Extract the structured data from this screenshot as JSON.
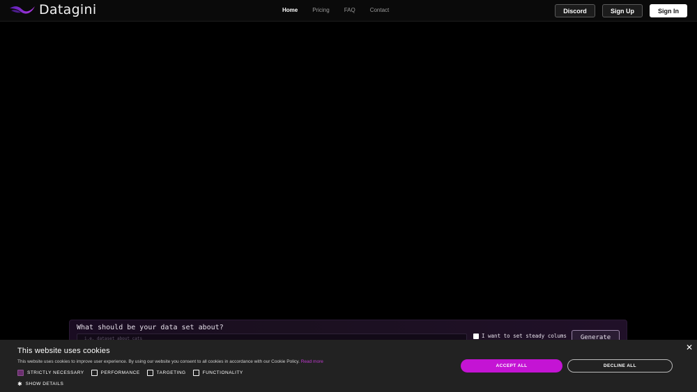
{
  "header": {
    "brand": "Datagini",
    "nav": [
      {
        "label": "Home",
        "active": true
      },
      {
        "label": "Pricing",
        "active": false
      },
      {
        "label": "FAQ",
        "active": false
      },
      {
        "label": "Contact",
        "active": false
      }
    ],
    "buttons": {
      "discord": "Discord",
      "sign_up": "Sign Up",
      "sign_in": "Sign In"
    },
    "logo_icon": "purple-wave-logo",
    "accent_color": "#7a2ad0"
  },
  "prompt": {
    "title": "What should be your data set about?",
    "placeholder": "i.e. dataset about cats",
    "steady_columns_label": "I want to set steady colums",
    "steady_columns_checked": false,
    "generate_label": "Generate"
  },
  "cookie_banner": {
    "title": "This website uses cookies",
    "description": "This website uses cookies to improve user experience. By using our website you consent to all cookies in accordance with our Cookie Policy.",
    "read_more": "Read more",
    "categories": [
      {
        "label": "STRICTLY NECESSARY",
        "checked": true
      },
      {
        "label": "PERFORMANCE",
        "checked": false
      },
      {
        "label": "TARGETING",
        "checked": false
      },
      {
        "label": "FUNCTIONALITY",
        "checked": false
      }
    ],
    "show_details": "SHOW DETAILS",
    "accept_all": "ACCEPT ALL",
    "decline_all": "DECLINE ALL",
    "close_icon": "close-icon",
    "accept_color": "#c414d4"
  }
}
